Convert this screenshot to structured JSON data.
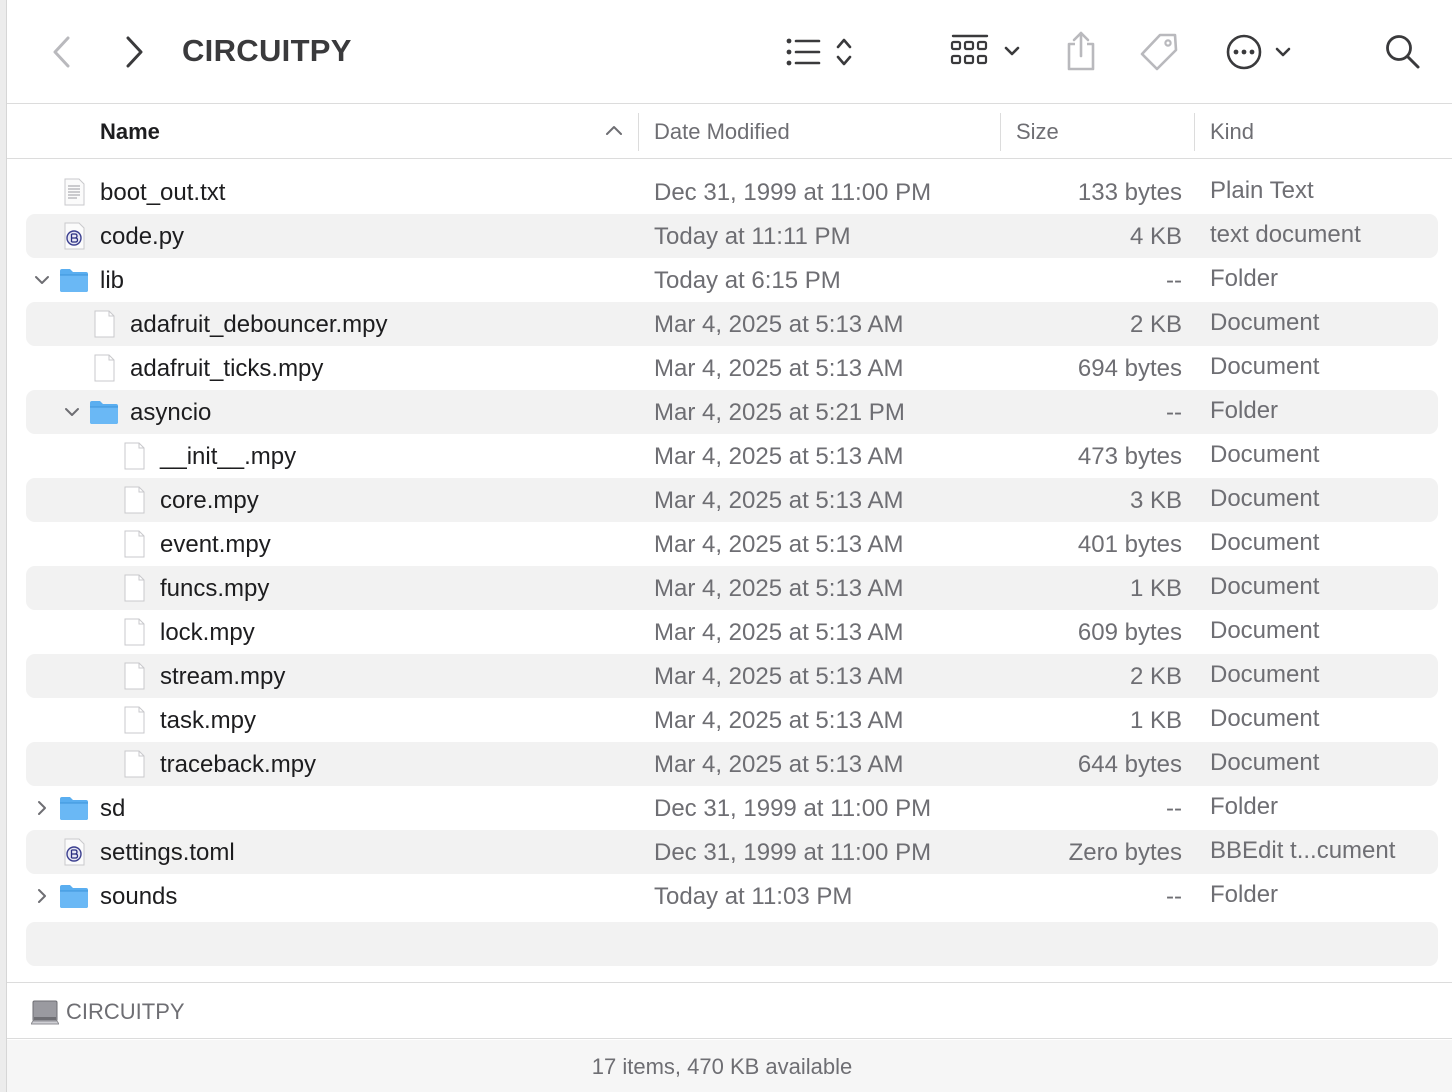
{
  "window": {
    "title": "CIRCUITPY"
  },
  "toolbar": {
    "back_icon": "chevron-left-icon",
    "forward_icon": "chevron-right-icon",
    "view_icon": "list-view-icon",
    "group_icon": "group-grid-icon",
    "share_icon": "share-icon",
    "tag_icon": "tag-icon",
    "action_icon": "ellipsis-circle-icon",
    "search_icon": "search-icon"
  },
  "columns": {
    "name": "Name",
    "date": "Date Modified",
    "size": "Size",
    "kind": "Kind"
  },
  "rows": [
    {
      "name": "boot_out.txt",
      "date": "Dec 31, 1999 at 11:00 PM",
      "size": "133 bytes",
      "kind": "Plain Text",
      "icon": "text-file-icon",
      "depth": 0,
      "disclosure": "none"
    },
    {
      "name": "code.py",
      "date": "Today at 11:11 PM",
      "size": "4 KB",
      "kind": "text document",
      "icon": "bbedit-file-icon",
      "depth": 0,
      "disclosure": "none"
    },
    {
      "name": "lib",
      "date": "Today at 6:15 PM",
      "size": "--",
      "kind": "Folder",
      "icon": "folder-icon",
      "depth": 0,
      "disclosure": "open"
    },
    {
      "name": "adafruit_debouncer.mpy",
      "date": "Mar 4, 2025 at 5:13 AM",
      "size": "2 KB",
      "kind": "Document",
      "icon": "document-icon",
      "depth": 1,
      "disclosure": "none"
    },
    {
      "name": "adafruit_ticks.mpy",
      "date": "Mar 4, 2025 at 5:13 AM",
      "size": "694 bytes",
      "kind": "Document",
      "icon": "document-icon",
      "depth": 1,
      "disclosure": "none"
    },
    {
      "name": "asyncio",
      "date": "Mar 4, 2025 at 5:21 PM",
      "size": "--",
      "kind": "Folder",
      "icon": "folder-icon",
      "depth": 1,
      "disclosure": "open"
    },
    {
      "name": "__init__.mpy",
      "date": "Mar 4, 2025 at 5:13 AM",
      "size": "473 bytes",
      "kind": "Document",
      "icon": "document-icon",
      "depth": 2,
      "disclosure": "none"
    },
    {
      "name": "core.mpy",
      "date": "Mar 4, 2025 at 5:13 AM",
      "size": "3 KB",
      "kind": "Document",
      "icon": "document-icon",
      "depth": 2,
      "disclosure": "none"
    },
    {
      "name": "event.mpy",
      "date": "Mar 4, 2025 at 5:13 AM",
      "size": "401 bytes",
      "kind": "Document",
      "icon": "document-icon",
      "depth": 2,
      "disclosure": "none"
    },
    {
      "name": "funcs.mpy",
      "date": "Mar 4, 2025 at 5:13 AM",
      "size": "1 KB",
      "kind": "Document",
      "icon": "document-icon",
      "depth": 2,
      "disclosure": "none"
    },
    {
      "name": "lock.mpy",
      "date": "Mar 4, 2025 at 5:13 AM",
      "size": "609 bytes",
      "kind": "Document",
      "icon": "document-icon",
      "depth": 2,
      "disclosure": "none"
    },
    {
      "name": "stream.mpy",
      "date": "Mar 4, 2025 at 5:13 AM",
      "size": "2 KB",
      "kind": "Document",
      "icon": "document-icon",
      "depth": 2,
      "disclosure": "none"
    },
    {
      "name": "task.mpy",
      "date": "Mar 4, 2025 at 5:13 AM",
      "size": "1 KB",
      "kind": "Document",
      "icon": "document-icon",
      "depth": 2,
      "disclosure": "none"
    },
    {
      "name": "traceback.mpy",
      "date": "Mar 4, 2025 at 5:13 AM",
      "size": "644 bytes",
      "kind": "Document",
      "icon": "document-icon",
      "depth": 2,
      "disclosure": "none"
    },
    {
      "name": "sd",
      "date": "Dec 31, 1999 at 11:00 PM",
      "size": "--",
      "kind": "Folder",
      "icon": "folder-icon",
      "depth": 0,
      "disclosure": "closed"
    },
    {
      "name": "settings.toml",
      "date": "Dec 31, 1999 at 11:00 PM",
      "size": "Zero bytes",
      "kind": "BBEdit t...cument",
      "icon": "bbedit-file-icon",
      "depth": 0,
      "disclosure": "none"
    },
    {
      "name": "sounds",
      "date": "Today at 11:03 PM",
      "size": "--",
      "kind": "Folder",
      "icon": "folder-icon",
      "depth": 0,
      "disclosure": "closed"
    }
  ],
  "pathbar": {
    "volume": "CIRCUITPY",
    "icon": "disk-icon"
  },
  "status": {
    "text": "17 items, 470 KB available"
  },
  "colors": {
    "folder": "#5aaef0",
    "row_alt": "#f2f2f2",
    "secondary_text": "#6e6e73"
  }
}
